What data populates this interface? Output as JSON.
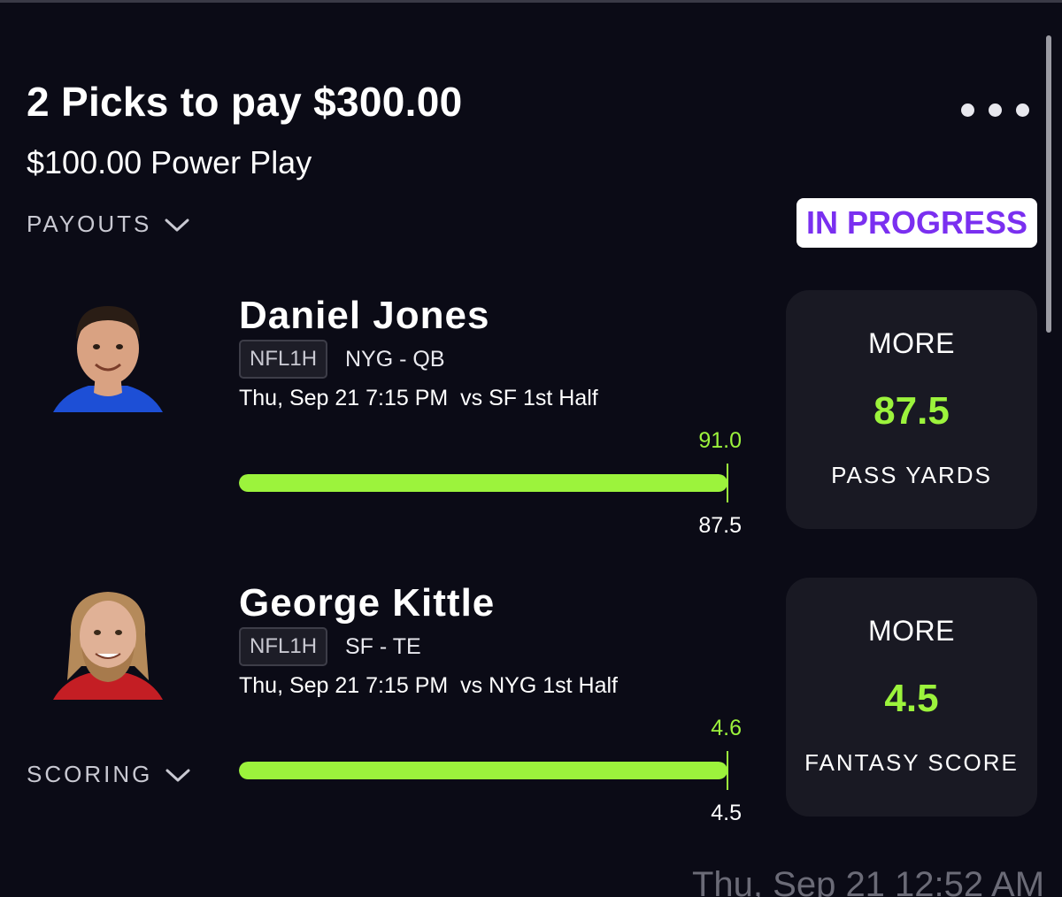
{
  "header": {
    "title": "2 Picks to pay $300.00",
    "subtitle": "$100.00 Power Play",
    "payouts_label": "PAYOUTS",
    "status": "IN PROGRESS",
    "more_menu_icon": "more-horizontal-icon"
  },
  "picks": [
    {
      "player": "Daniel Jones",
      "league": "NFL1H",
      "team_position": "NYG - QB",
      "game_info": "Thu, Sep 21 7:15 PM  vs SF 1st Half",
      "actual": "91.0",
      "line_value": "87.5",
      "progress_fraction": 1.0,
      "direction": "MORE",
      "stat": "PASS YARDS",
      "jersey_color": "#1d4fd6",
      "skin_color": "#d9a282",
      "hair_color": "#2a1d15"
    },
    {
      "player": "George Kittle",
      "league": "NFL1H",
      "team_position": "SF - TE",
      "game_info": "Thu, Sep 21 7:15 PM  vs NYG 1st Half",
      "actual": "4.6",
      "line_value": "4.5",
      "progress_fraction": 1.0,
      "direction": "MORE",
      "stat": "FANTASY SCORE",
      "jersey_color": "#c41e24",
      "skin_color": "#e0b196",
      "hair_color": "#b58a5a"
    }
  ],
  "footer": {
    "scoring_label": "SCORING",
    "timestamp": "Thu, Sep 21 12:52 AM"
  },
  "colors": {
    "background": "#0b0b16",
    "accent_green": "#9cf33c",
    "status_purple": "#7a2ff0",
    "card_background": "#191923"
  }
}
